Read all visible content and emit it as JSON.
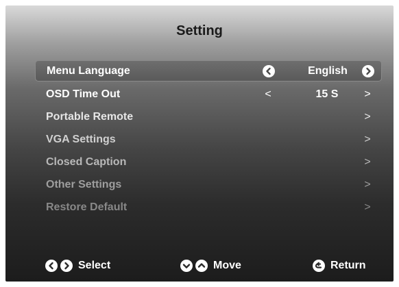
{
  "title": "Setting",
  "menu": {
    "items": [
      {
        "label": "Menu Language",
        "value": "English",
        "prev": "",
        "next": ""
      },
      {
        "label": "OSD Time Out",
        "value": "15 S",
        "prev": "<",
        "next": ">"
      },
      {
        "label": "Portable Remote",
        "value": "",
        "next": ">"
      },
      {
        "label": "VGA Settings",
        "value": "",
        "next": ">"
      },
      {
        "label": "Closed Caption",
        "value": "",
        "next": ">"
      },
      {
        "label": "Other Settings",
        "value": "",
        "next": ">"
      },
      {
        "label": "Restore Default",
        "value": "",
        "next": ">"
      }
    ]
  },
  "footer": {
    "select_label": "Select",
    "move_label": "Move",
    "return_label": "Return"
  },
  "icons": {
    "left": "chevron-left-circle-icon",
    "right": "chevron-right-circle-icon",
    "down": "chevron-down-circle-icon",
    "up": "chevron-up-circle-icon",
    "return": "return-circle-icon"
  }
}
